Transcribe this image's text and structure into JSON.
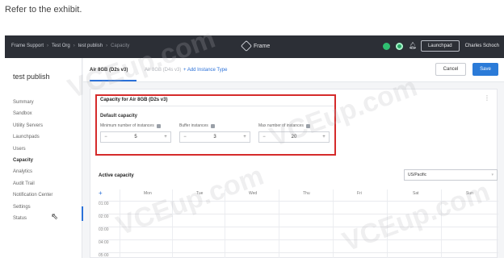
{
  "caption": "Refer to the exhibit.",
  "breadcrumbs": [
    "Frame Support",
    "Test Org",
    "test publish",
    "Capacity"
  ],
  "brand": "Frame",
  "topbar": {
    "launchpad_label": "Launchpad",
    "user": "Charles Schoch"
  },
  "sidebar": {
    "title": "test publish",
    "items": [
      "Summary",
      "Sandbox",
      "Utility Servers",
      "Launchpads",
      "Users",
      "Capacity",
      "Analytics",
      "Audit Trail",
      "Notification Center",
      "Settings",
      "Status"
    ],
    "active": "Capacity"
  },
  "tabs": {
    "active": "Air 8GB (D2s v3)",
    "inactive": "Air 8GB (D4s v3)",
    "add": "Add Instance Type"
  },
  "actions": {
    "cancel": "Cancel",
    "save": "Save"
  },
  "capacity": {
    "title": "Capacity for Air 8GB (D2s v3)",
    "default_title": "Default capacity",
    "fields": [
      {
        "label": "Minimum number of instances",
        "value": "5"
      },
      {
        "label": "Buffer instances",
        "value": "3"
      },
      {
        "label": "Max number of instances",
        "value": "20"
      }
    ]
  },
  "active_capacity": {
    "title": "Active capacity",
    "timezone": "US/Pacific",
    "days": [
      "Mon",
      "Tue",
      "Wed",
      "Thu",
      "Fri",
      "Sat",
      "Sun"
    ],
    "times": [
      "01:00",
      "02:00",
      "03:00",
      "04:00",
      "05:00"
    ]
  },
  "watermark": "VCEup.com"
}
